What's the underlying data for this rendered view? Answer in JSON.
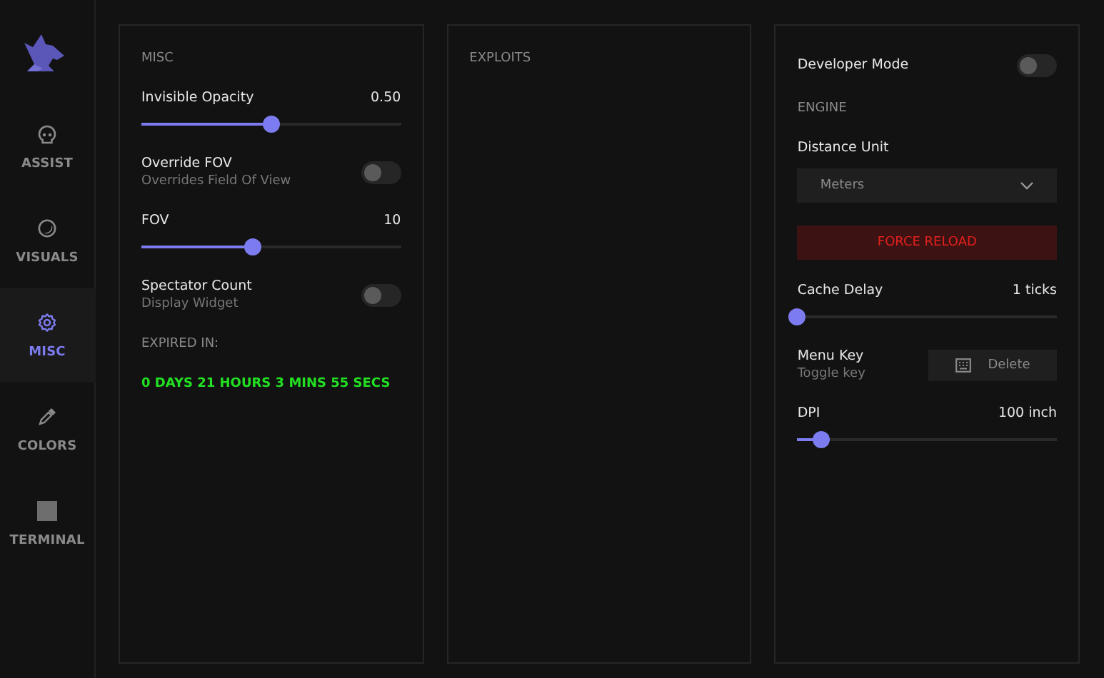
{
  "sidebar": {
    "items": [
      {
        "label": "ASSIST",
        "selected": false
      },
      {
        "label": "VISUALS",
        "selected": false
      },
      {
        "label": "MISC",
        "selected": true
      },
      {
        "label": "COLORS",
        "selected": false
      },
      {
        "label": "TERMINAL",
        "selected": false
      }
    ]
  },
  "panels": [
    {
      "items": [
        {
          "kind": "heading",
          "text": "MISC"
        },
        {
          "kind": "slider",
          "label": "Invisible Opacity",
          "value": "0.50",
          "level": 0.5
        },
        {
          "kind": "toggle",
          "label": "Override FOV",
          "description": "Overrides Field Of View",
          "on": false
        },
        {
          "kind": "slider",
          "label": "FOV",
          "value": "10",
          "level": 0.43
        },
        {
          "kind": "toggle",
          "label": "Spectator Count",
          "description": "Display Widget",
          "on": false
        },
        {
          "kind": "heading",
          "text": "EXPIRED IN:"
        },
        {
          "kind": "countdown",
          "text": "0 DAYS 21 HOURS 3 MINS 55 SECS"
        }
      ]
    },
    {
      "items": [
        {
          "kind": "heading",
          "text": "EXPLOITS"
        }
      ]
    },
    {
      "items": [
        {
          "kind": "toggle",
          "label": "Developer Mode",
          "on": false
        },
        {
          "kind": "heading",
          "text": "ENGINE"
        },
        {
          "kind": "dropdown",
          "label": "Distance Unit",
          "value": "Meters"
        },
        {
          "kind": "danger_button",
          "label": "FORCE RELOAD"
        },
        {
          "kind": "slider",
          "label": "Cache Delay",
          "value": "1 ticks",
          "level": 0
        },
        {
          "kind": "keybind",
          "label": "Menu Key",
          "description": "Toggle key",
          "key": "Delete"
        },
        {
          "kind": "slider",
          "label": "DPI",
          "value": "100 inch",
          "level": 0.09
        }
      ]
    }
  ]
}
